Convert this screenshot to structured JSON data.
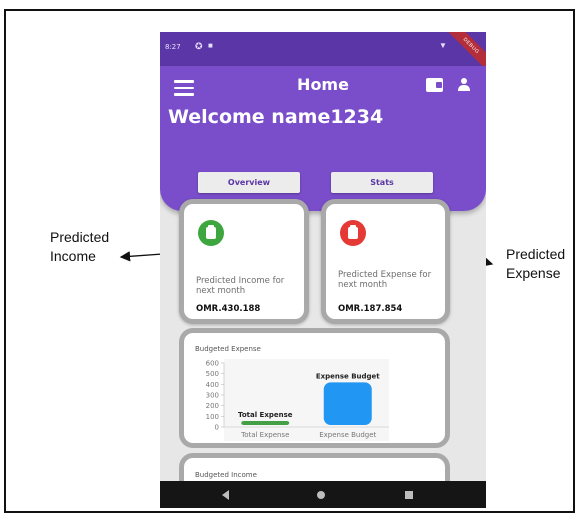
{
  "status_bar": {
    "time": "8:27",
    "debug_label": "DEBUG"
  },
  "app_bar": {
    "title": "Home",
    "welcome": "Welcome name1234"
  },
  "tabs": [
    {
      "label": "Overview"
    },
    {
      "label": "Stats"
    }
  ],
  "cards": {
    "income": {
      "label": "Predicted Income for next month",
      "value": "OMR.430.188",
      "color": "#3ea63e"
    },
    "expense": {
      "label": "Predicted Expense for next month",
      "value": "OMR.187.854",
      "color": "#e53935"
    }
  },
  "annotations": {
    "left_line1": "Predicted",
    "left_line2": "Income",
    "right_line1": "Predicted",
    "right_line2": "Expense"
  },
  "budgeted_income_title": "Budgeted Income",
  "chart_data": {
    "type": "bar",
    "title": "Budgeted Expense",
    "categories": [
      "Total Expense",
      "Expense Budget"
    ],
    "values": [
      25,
      400
    ],
    "data_labels": [
      "Total Expense",
      "Expense Budget"
    ],
    "colors": [
      "#43a047",
      "#2196f3"
    ],
    "ylim": [
      0,
      600
    ],
    "yticks": [
      0,
      100,
      200,
      300,
      400,
      500,
      600
    ],
    "grid": false
  }
}
